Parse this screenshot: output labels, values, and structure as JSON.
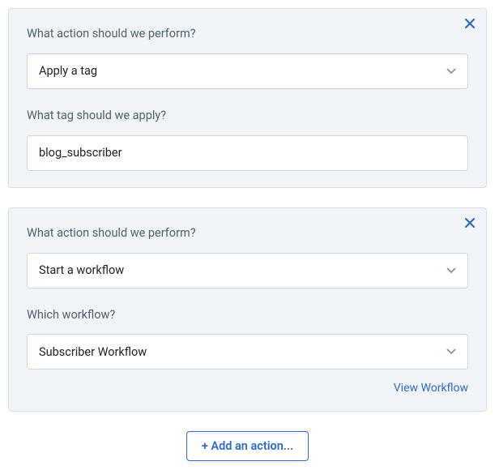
{
  "actions": [
    {
      "label_action": "What action should we perform?",
      "selected_action": "Apply a tag",
      "label_param": "What tag should we apply?",
      "param_type": "text",
      "param_value": "blog_subscriber",
      "view_link": null
    },
    {
      "label_action": "What action should we perform?",
      "selected_action": "Start a workflow",
      "label_param": "Which workflow?",
      "param_type": "select",
      "param_value": "Subscriber Workflow",
      "view_link": "View Workflow"
    }
  ],
  "add_action_label": "+ Add an action...",
  "colors": {
    "card_bg": "#f1f4f8",
    "card_border": "#d6dde5",
    "link": "#2e6ad1",
    "close_icon": "#2e6ad1",
    "caret": "#8a94a1"
  }
}
